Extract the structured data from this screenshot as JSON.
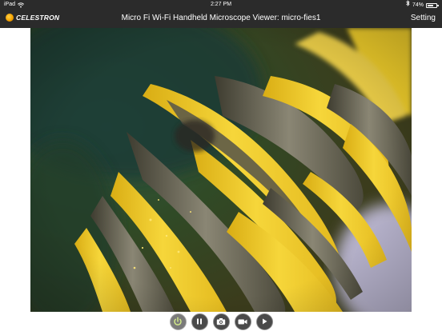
{
  "status_bar": {
    "device": "iPad",
    "wifi_icon": "wifi-icon",
    "time": "2:27 PM",
    "bluetooth_icon": "bluetooth-icon",
    "battery": "74%",
    "battery_level": 0.74
  },
  "header": {
    "logo_text": "CELESTRON",
    "title": "Micro Fi Wi-Fi Handheld Microscope Viewer: micro-fies1",
    "setting_label": "Setting"
  },
  "controls": {
    "buttons": [
      {
        "name": "power-button",
        "icon": "power-icon"
      },
      {
        "name": "pause-button",
        "icon": "pause-icon"
      },
      {
        "name": "snapshot-button",
        "icon": "camera-icon"
      },
      {
        "name": "record-video-button",
        "icon": "video-camera-icon"
      },
      {
        "name": "play-button",
        "icon": "play-icon"
      }
    ]
  },
  "colors": {
    "bar_background": "#2b2b2b",
    "petal_yellow": "#f2cf2a",
    "petal_dark": "#5a5646",
    "background_green": "#2f3a1c"
  }
}
